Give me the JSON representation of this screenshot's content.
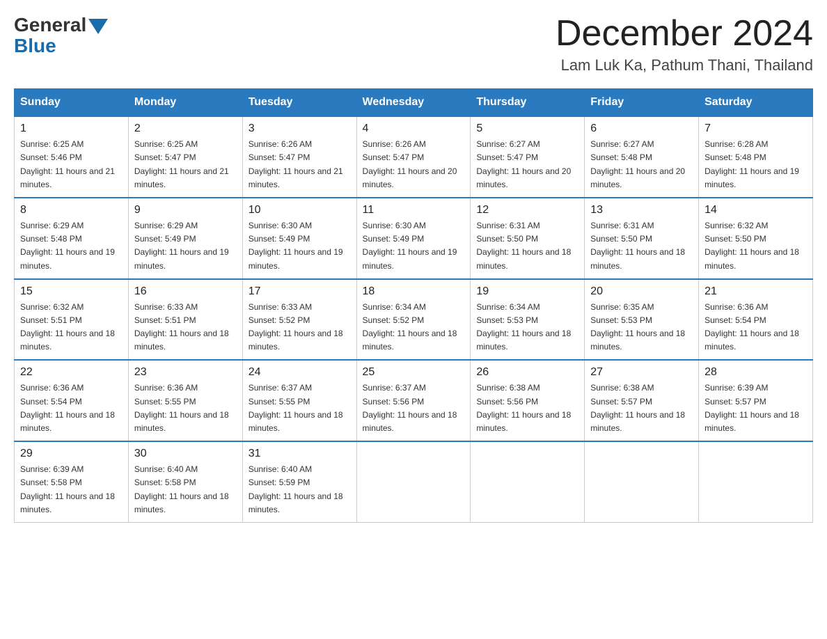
{
  "header": {
    "logo_general": "General",
    "logo_blue": "Blue",
    "month_title": "December 2024",
    "location": "Lam Luk Ka, Pathum Thani, Thailand"
  },
  "days_of_week": [
    "Sunday",
    "Monday",
    "Tuesday",
    "Wednesday",
    "Thursday",
    "Friday",
    "Saturday"
  ],
  "weeks": [
    [
      {
        "day": "1",
        "sunrise": "6:25 AM",
        "sunset": "5:46 PM",
        "daylight": "11 hours and 21 minutes."
      },
      {
        "day": "2",
        "sunrise": "6:25 AM",
        "sunset": "5:47 PM",
        "daylight": "11 hours and 21 minutes."
      },
      {
        "day": "3",
        "sunrise": "6:26 AM",
        "sunset": "5:47 PM",
        "daylight": "11 hours and 21 minutes."
      },
      {
        "day": "4",
        "sunrise": "6:26 AM",
        "sunset": "5:47 PM",
        "daylight": "11 hours and 20 minutes."
      },
      {
        "day": "5",
        "sunrise": "6:27 AM",
        "sunset": "5:47 PM",
        "daylight": "11 hours and 20 minutes."
      },
      {
        "day": "6",
        "sunrise": "6:27 AM",
        "sunset": "5:48 PM",
        "daylight": "11 hours and 20 minutes."
      },
      {
        "day": "7",
        "sunrise": "6:28 AM",
        "sunset": "5:48 PM",
        "daylight": "11 hours and 19 minutes."
      }
    ],
    [
      {
        "day": "8",
        "sunrise": "6:29 AM",
        "sunset": "5:48 PM",
        "daylight": "11 hours and 19 minutes."
      },
      {
        "day": "9",
        "sunrise": "6:29 AM",
        "sunset": "5:49 PM",
        "daylight": "11 hours and 19 minutes."
      },
      {
        "day": "10",
        "sunrise": "6:30 AM",
        "sunset": "5:49 PM",
        "daylight": "11 hours and 19 minutes."
      },
      {
        "day": "11",
        "sunrise": "6:30 AM",
        "sunset": "5:49 PM",
        "daylight": "11 hours and 19 minutes."
      },
      {
        "day": "12",
        "sunrise": "6:31 AM",
        "sunset": "5:50 PM",
        "daylight": "11 hours and 18 minutes."
      },
      {
        "day": "13",
        "sunrise": "6:31 AM",
        "sunset": "5:50 PM",
        "daylight": "11 hours and 18 minutes."
      },
      {
        "day": "14",
        "sunrise": "6:32 AM",
        "sunset": "5:50 PM",
        "daylight": "11 hours and 18 minutes."
      }
    ],
    [
      {
        "day": "15",
        "sunrise": "6:32 AM",
        "sunset": "5:51 PM",
        "daylight": "11 hours and 18 minutes."
      },
      {
        "day": "16",
        "sunrise": "6:33 AM",
        "sunset": "5:51 PM",
        "daylight": "11 hours and 18 minutes."
      },
      {
        "day": "17",
        "sunrise": "6:33 AM",
        "sunset": "5:52 PM",
        "daylight": "11 hours and 18 minutes."
      },
      {
        "day": "18",
        "sunrise": "6:34 AM",
        "sunset": "5:52 PM",
        "daylight": "11 hours and 18 minutes."
      },
      {
        "day": "19",
        "sunrise": "6:34 AM",
        "sunset": "5:53 PM",
        "daylight": "11 hours and 18 minutes."
      },
      {
        "day": "20",
        "sunrise": "6:35 AM",
        "sunset": "5:53 PM",
        "daylight": "11 hours and 18 minutes."
      },
      {
        "day": "21",
        "sunrise": "6:36 AM",
        "sunset": "5:54 PM",
        "daylight": "11 hours and 18 minutes."
      }
    ],
    [
      {
        "day": "22",
        "sunrise": "6:36 AM",
        "sunset": "5:54 PM",
        "daylight": "11 hours and 18 minutes."
      },
      {
        "day": "23",
        "sunrise": "6:36 AM",
        "sunset": "5:55 PM",
        "daylight": "11 hours and 18 minutes."
      },
      {
        "day": "24",
        "sunrise": "6:37 AM",
        "sunset": "5:55 PM",
        "daylight": "11 hours and 18 minutes."
      },
      {
        "day": "25",
        "sunrise": "6:37 AM",
        "sunset": "5:56 PM",
        "daylight": "11 hours and 18 minutes."
      },
      {
        "day": "26",
        "sunrise": "6:38 AM",
        "sunset": "5:56 PM",
        "daylight": "11 hours and 18 minutes."
      },
      {
        "day": "27",
        "sunrise": "6:38 AM",
        "sunset": "5:57 PM",
        "daylight": "11 hours and 18 minutes."
      },
      {
        "day": "28",
        "sunrise": "6:39 AM",
        "sunset": "5:57 PM",
        "daylight": "11 hours and 18 minutes."
      }
    ],
    [
      {
        "day": "29",
        "sunrise": "6:39 AM",
        "sunset": "5:58 PM",
        "daylight": "11 hours and 18 minutes."
      },
      {
        "day": "30",
        "sunrise": "6:40 AM",
        "sunset": "5:58 PM",
        "daylight": "11 hours and 18 minutes."
      },
      {
        "day": "31",
        "sunrise": "6:40 AM",
        "sunset": "5:59 PM",
        "daylight": "11 hours and 18 minutes."
      },
      null,
      null,
      null,
      null
    ]
  ]
}
